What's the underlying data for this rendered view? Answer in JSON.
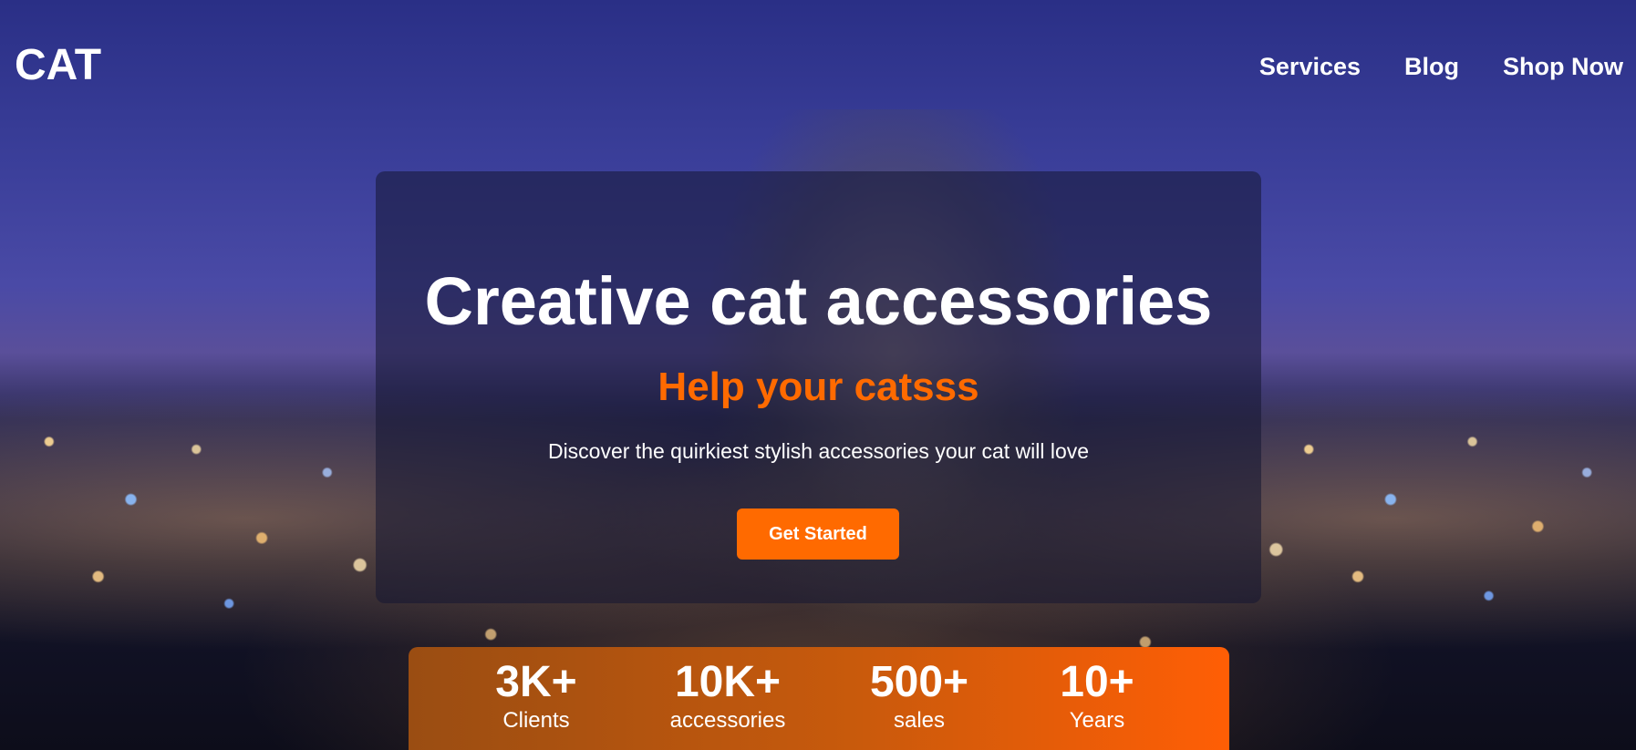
{
  "brand": {
    "logo": "CAT"
  },
  "nav": {
    "items": [
      "Services",
      "Blog",
      "Shop Now"
    ]
  },
  "hero": {
    "title": "Creative cat accessories",
    "subtitle": "Help your catsss",
    "description": "Discover the quirkiest stylish accessories your cat will love",
    "cta_label": "Get Started"
  },
  "stats": [
    {
      "value": "3K+",
      "label": "Clients"
    },
    {
      "value": "10K+",
      "label": "accessories"
    },
    {
      "value": "500+",
      "label": "sales"
    },
    {
      "value": "10+",
      "label": "Years"
    }
  ],
  "colors": {
    "accent": "#ff6a00",
    "text": "#ffffff"
  }
}
